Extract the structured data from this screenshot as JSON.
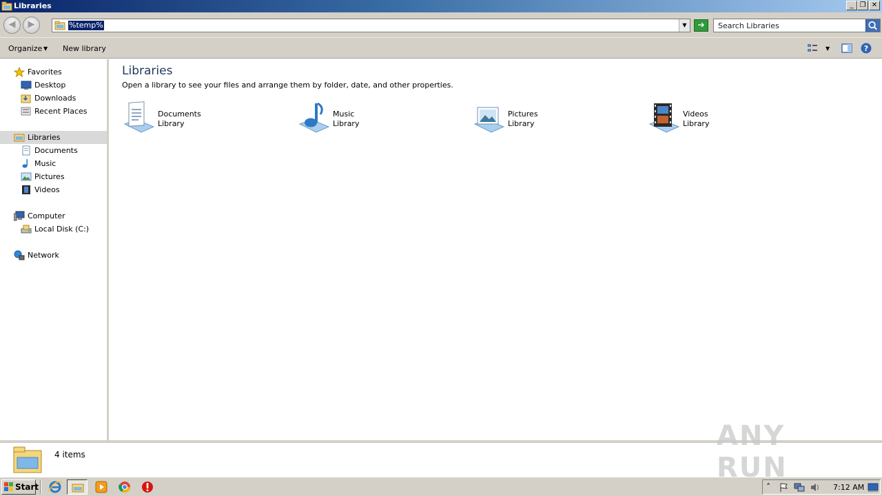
{
  "window": {
    "title": "Libraries",
    "controls": {
      "minimize": "_",
      "restore": "❐",
      "close": "✕"
    }
  },
  "address": {
    "back_icon": "back-arrow-icon",
    "forward_icon": "forward-arrow-icon",
    "value": "%temp%",
    "dropdown_icon": "chevron-down-icon",
    "go_icon": "go-arrow-icon",
    "search_placeholder": "Search Libraries"
  },
  "commands": {
    "organize": "Organize",
    "organize_arrow": "▼",
    "new_library": "New library",
    "view_arrow": "▼"
  },
  "nav": {
    "favorites": {
      "label": "Favorites",
      "items": [
        {
          "label": "Desktop"
        },
        {
          "label": "Downloads"
        },
        {
          "label": "Recent Places"
        }
      ]
    },
    "libraries": {
      "label": "Libraries",
      "items": [
        {
          "label": "Documents"
        },
        {
          "label": "Music"
        },
        {
          "label": "Pictures"
        },
        {
          "label": "Videos"
        }
      ]
    },
    "computer": {
      "label": "Computer",
      "items": [
        {
          "label": "Local Disk (C:)"
        }
      ]
    },
    "network": {
      "label": "Network"
    }
  },
  "main": {
    "heading": "Libraries",
    "description": "Open a library to see your files and arrange them by folder, date, and other properties.",
    "libraries": [
      {
        "name": "Documents",
        "type": "Library",
        "icon": "documents-library-icon"
      },
      {
        "name": "Music",
        "type": "Library",
        "icon": "music-library-icon"
      },
      {
        "name": "Pictures",
        "type": "Library",
        "icon": "pictures-library-icon"
      },
      {
        "name": "Videos",
        "type": "Library",
        "icon": "videos-library-icon"
      }
    ]
  },
  "status": {
    "count": "4 items"
  },
  "watermark": "ANY RUN",
  "taskbar": {
    "start": "Start",
    "clock": "7:12 AM",
    "tray_expand": "˄"
  },
  "colors": {
    "titlebar_start": "#0a246a",
    "titlebar_end": "#a6caf0",
    "chrome": "#d4d0c8",
    "selection": "#0a246a",
    "heading": "#1e395b"
  }
}
